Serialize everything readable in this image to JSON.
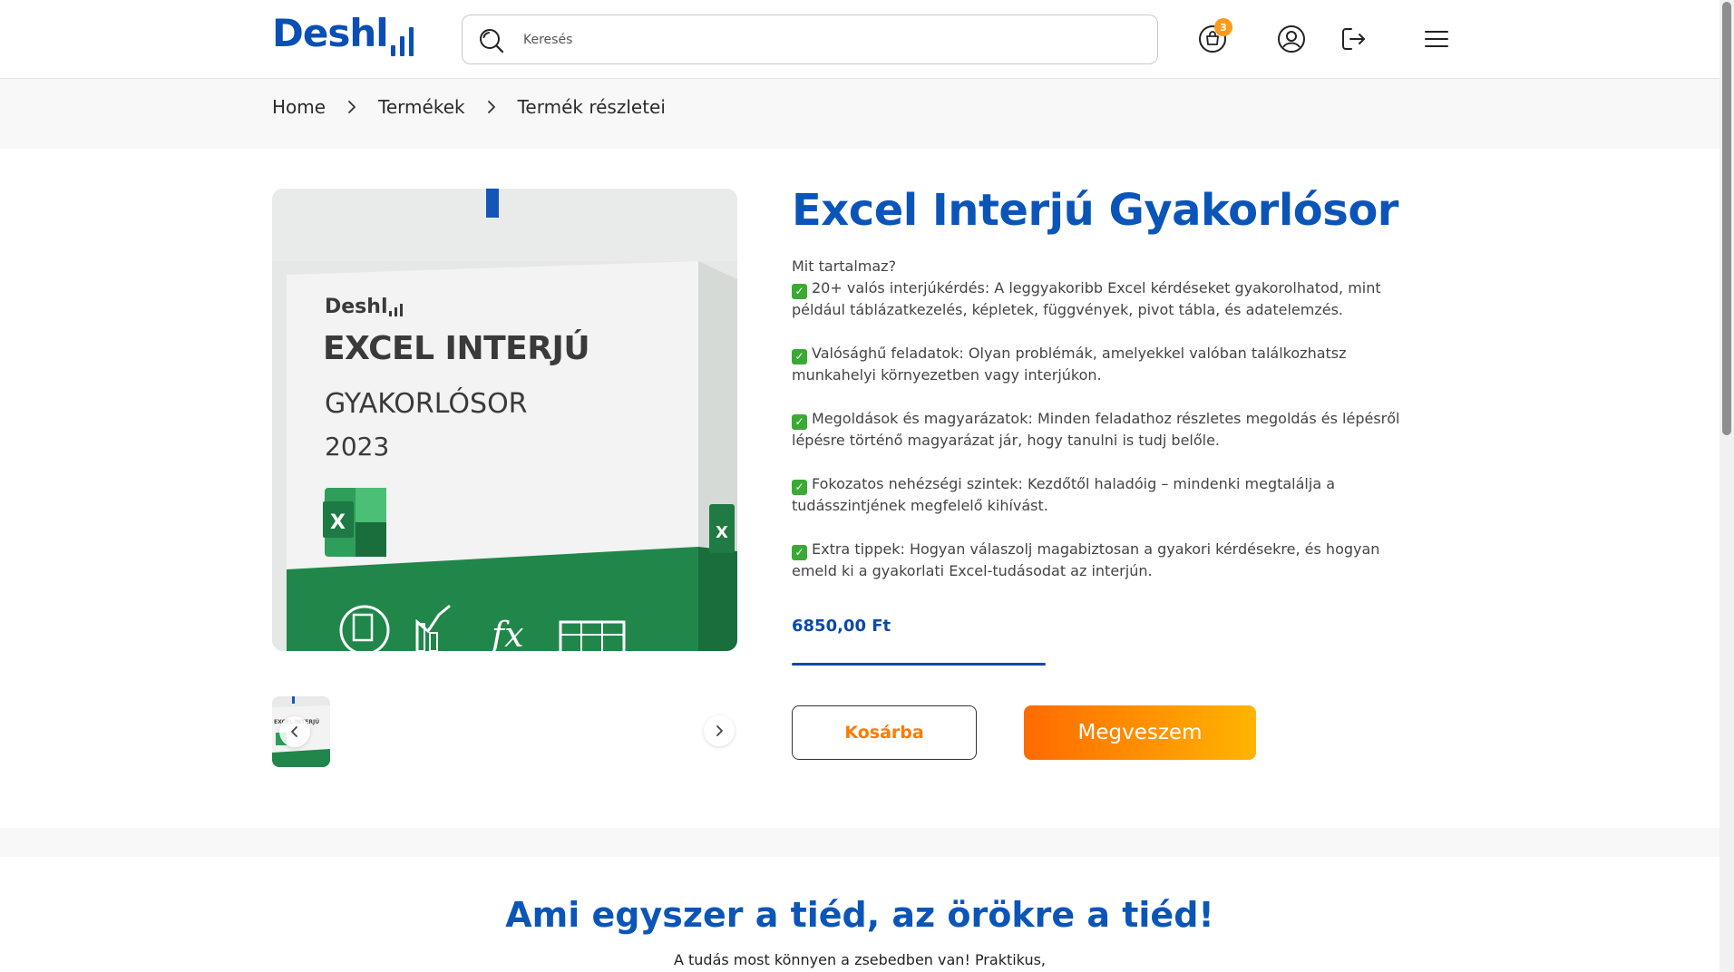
{
  "header": {
    "logo_text": "Deshl",
    "search_placeholder": "Keresés",
    "cart_count": "3",
    "icons": [
      "search-icon",
      "cart-icon",
      "user-icon",
      "logout-icon",
      "hamburger-menu-icon"
    ]
  },
  "breadcrumb": {
    "items": [
      "Home",
      "Termékek",
      "Termék részletei"
    ]
  },
  "product": {
    "title": "Excel Interjú Gyakorlósor",
    "image_text": {
      "brand": "Deshl",
      "line1": "EXCEL INTERJÚ",
      "line2": "GYAKORLÓSOR",
      "line3": "2023"
    },
    "intro": "Mit tartalmaz?",
    "features": [
      "20+ valós interjúkérdés: A leggyakoribb Excel kérdéseket gyakorolhatod, mint például táblázatkezelés, képletek, függvények, pivot tábla, és adatelemzés.",
      "Valósághű feladatok: Olyan problémák, amelyekkel valóban találkozhatsz munkahelyi környezetben vagy interjúkon.",
      "Megoldások és magyarázatok: Minden feladathoz részletes megoldás és lépésről lépésre történő magyarázat jár, hogy tanulni is tudj belőle.",
      "Fokozatos nehézségi szintek: Kezdőtől haladóig – mindenki megtalálja a tudásszintjének megfelelő kihívást.",
      "Extra tippek: Hogyan válaszolj magabiztosan a gyakori kérdésekre, és hogyan emeld ki a gyakorlati Excel-tudásodat az interjún."
    ],
    "price": "6850,00 Ft",
    "add_to_cart_label": "Kosárba",
    "buy_label": "Megveszem"
  },
  "section": {
    "title": "Ami egyszer a tiéd, az örökre a tiéd!",
    "subtitle": "A tudás most könnyen a zsebedben van! Praktikus,"
  },
  "colors": {
    "brand_blue": "#0b55b8",
    "accent_orange": "#ff7a00",
    "excel_green": "#21864a"
  }
}
